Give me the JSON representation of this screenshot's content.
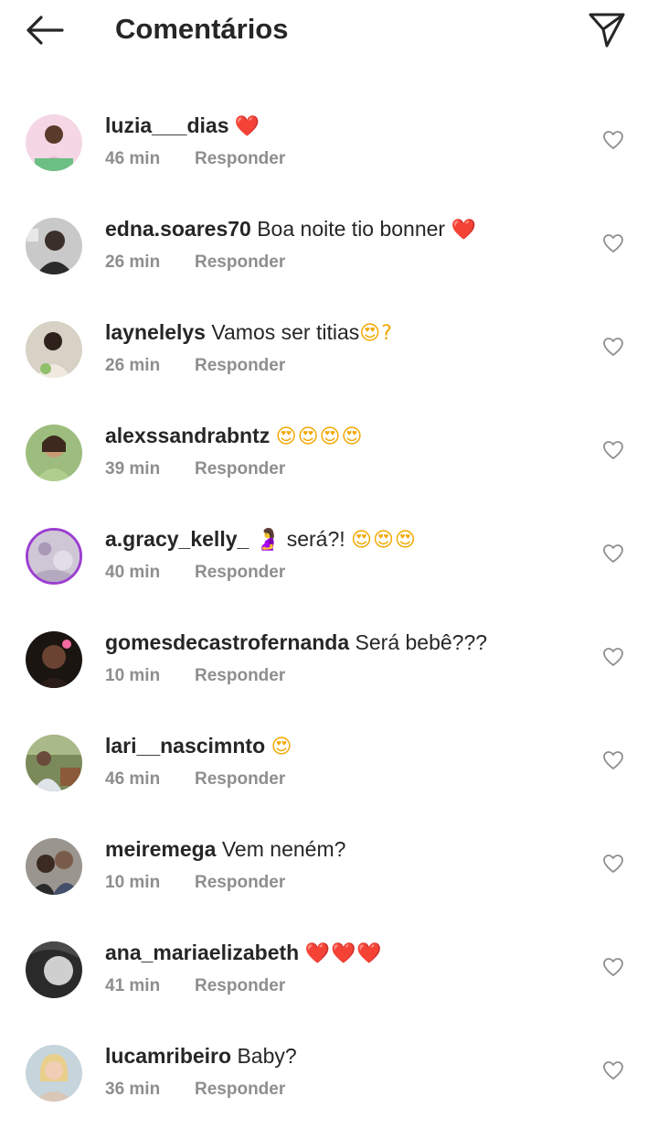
{
  "header": {
    "title": "Comentários",
    "back_icon": "arrow-left-icon",
    "send_icon": "paper-plane-icon"
  },
  "colors": {
    "text": "#262626",
    "meta": "#8e8e8e",
    "story_ring": "#9b3fd0"
  },
  "reply_label": "Responder",
  "comments": [
    {
      "username": "luzia___dias",
      "text": "",
      "emoji": "❤️",
      "time": "46 min"
    },
    {
      "username": "edna.soares70",
      "text": "Boa noite tio bonner",
      "emoji": "❤️",
      "time": "26 min"
    },
    {
      "username": "laynelelys",
      "text": "Vamos ser titias",
      "emoji": "😍?",
      "time": "26 min"
    },
    {
      "username": "alexssandrabntz",
      "text": "",
      "emoji": "😍😍😍😍",
      "time": "39 min"
    },
    {
      "username": "a.gracy_kelly_",
      "text": "🤰 será?!",
      "emoji": "😍😍😍",
      "time": "40 min"
    },
    {
      "username": "gomesdecastrofernanda",
      "text": "Será bebê???",
      "emoji": "",
      "time": "10 min"
    },
    {
      "username": "lari__nascimnto",
      "text": "",
      "emoji": "😍",
      "time": "46 min"
    },
    {
      "username": "meiremega",
      "text": "Vem neném?",
      "emoji": "",
      "time": "10 min"
    },
    {
      "username": "ana_mariaelizabeth",
      "text": "",
      "emoji": "❤️❤️❤️",
      "time": "41 min"
    },
    {
      "username": "lucamribeiro",
      "text": "Baby?",
      "emoji": "",
      "time": "36 min"
    }
  ]
}
